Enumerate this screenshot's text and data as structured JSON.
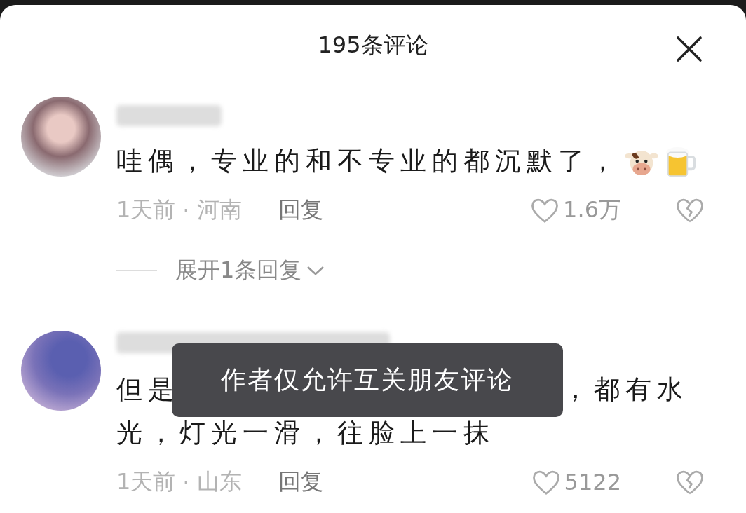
{
  "sheet": {
    "title": "195条评论"
  },
  "comments": [
    {
      "text_parts": [
        "哇偶，专业的和不专业的都沉默了，"
      ],
      "time": "1天前",
      "location": "河南",
      "reply": "回复",
      "likes": "1.6万",
      "expand": "展开1条回复",
      "separator": "·"
    },
    {
      "text_parts": [
        "但是",
        "，都有水",
        "光，灯光一滑，往脸上一抹"
      ],
      "time": "1天前",
      "location": "山东",
      "reply": "回复",
      "likes": "5122",
      "separator": "·"
    }
  ],
  "toast": {
    "text": "作者仅允许互关朋友评论"
  }
}
